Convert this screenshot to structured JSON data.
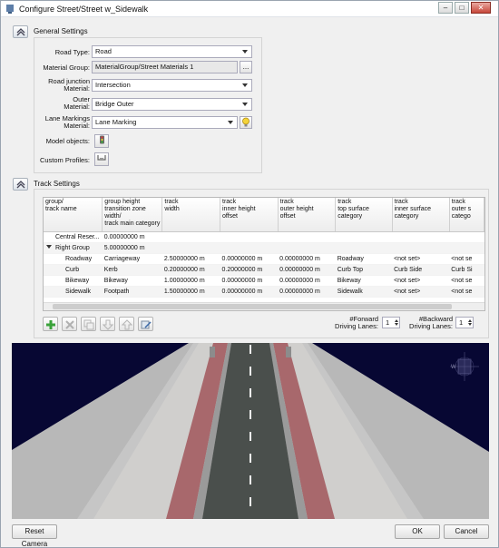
{
  "window": {
    "title": "Configure Street/Street w_Sidewalk",
    "controls": {
      "minimize": "–",
      "maximize": "□",
      "close": "✕"
    }
  },
  "general": {
    "section_label": "General Settings",
    "road_type": {
      "label": "Road Type:",
      "value": "Road"
    },
    "material_group": {
      "label": "Material Group:",
      "value": "MaterialGroup/Street Materials 1",
      "browse": "..."
    },
    "road_junction": {
      "label": "Road junction\nMaterial:",
      "value": "Intersection"
    },
    "outer_material": {
      "label": "Outer\nMaterial:",
      "value": "Bridge Outer"
    },
    "lane_markings": {
      "label": "Lane Markings\nMaterial:",
      "value": "Lane Marking"
    },
    "model_objects": {
      "label": "Model objects:"
    },
    "custom_profiles": {
      "label": "Custom Profiles:"
    }
  },
  "tracks": {
    "section_label": "Track Settings",
    "columns": [
      "group/\ntrack name",
      "group height\ntransition zone\nwidth/\ntrack main category",
      "track\nwidth",
      "track\ninner height\noffset",
      "track\nouter height\noffset",
      "track\ntop surface\ncategory",
      "track\ninner surface\ncategory",
      "track\nouter s\ncatego"
    ],
    "rows": [
      {
        "name": "Central Reser...",
        "c1": "0.00000000 m",
        "c2": "",
        "c3": "",
        "c4": "",
        "c5": "",
        "c6": "",
        "c7": ""
      },
      {
        "name": "Right Group",
        "c1": "5.00000000 m",
        "c2": "",
        "c3": "",
        "c4": "",
        "c5": "",
        "c6": "",
        "c7": ""
      },
      {
        "name": "Roadway",
        "c1": "Carriageway",
        "c2": "2.50000000 m",
        "c3": "0.00000000 m",
        "c4": "0.00000000 m",
        "c5": "Roadway",
        "c6": "<not set>",
        "c7": "<not se"
      },
      {
        "name": "Curb",
        "c1": "Kerb",
        "c2": "0.20000000 m",
        "c3": "0.20000000 m",
        "c4": "0.00000000 m",
        "c5": "Curb Top",
        "c6": "Curb Side",
        "c7": "Curb Si"
      },
      {
        "name": "Bikeway",
        "c1": "Bikeway",
        "c2": "1.00000000 m",
        "c3": "0.00000000 m",
        "c4": "0.00000000 m",
        "c5": "Bikeway",
        "c6": "<not set>",
        "c7": "<not se"
      },
      {
        "name": "Sidewalk",
        "c1": "Footpath",
        "c2": "1.50000000 m",
        "c3": "0.00000000 m",
        "c4": "0.00000000 m",
        "c5": "Sidewalk",
        "c6": "<not set>",
        "c7": "<not se"
      }
    ],
    "forward_lanes": {
      "label": "#Forward\nDriving Lanes:",
      "value": "1"
    },
    "backward_lanes": {
      "label": "#Backward\nDriving Lanes:",
      "value": "1"
    }
  },
  "viewport": {
    "compass_letter": "W"
  },
  "footer": {
    "reset_camera": "Reset Camera",
    "ok": "OK",
    "cancel": "Cancel"
  },
  "colors": {
    "sky": "#070733",
    "ground": "#b7b7b7",
    "asphalt": "#4a4f4c",
    "bikeway": "#a8686c",
    "sidewalk": "#bcbcbc",
    "add_green": "#3aa23a"
  }
}
